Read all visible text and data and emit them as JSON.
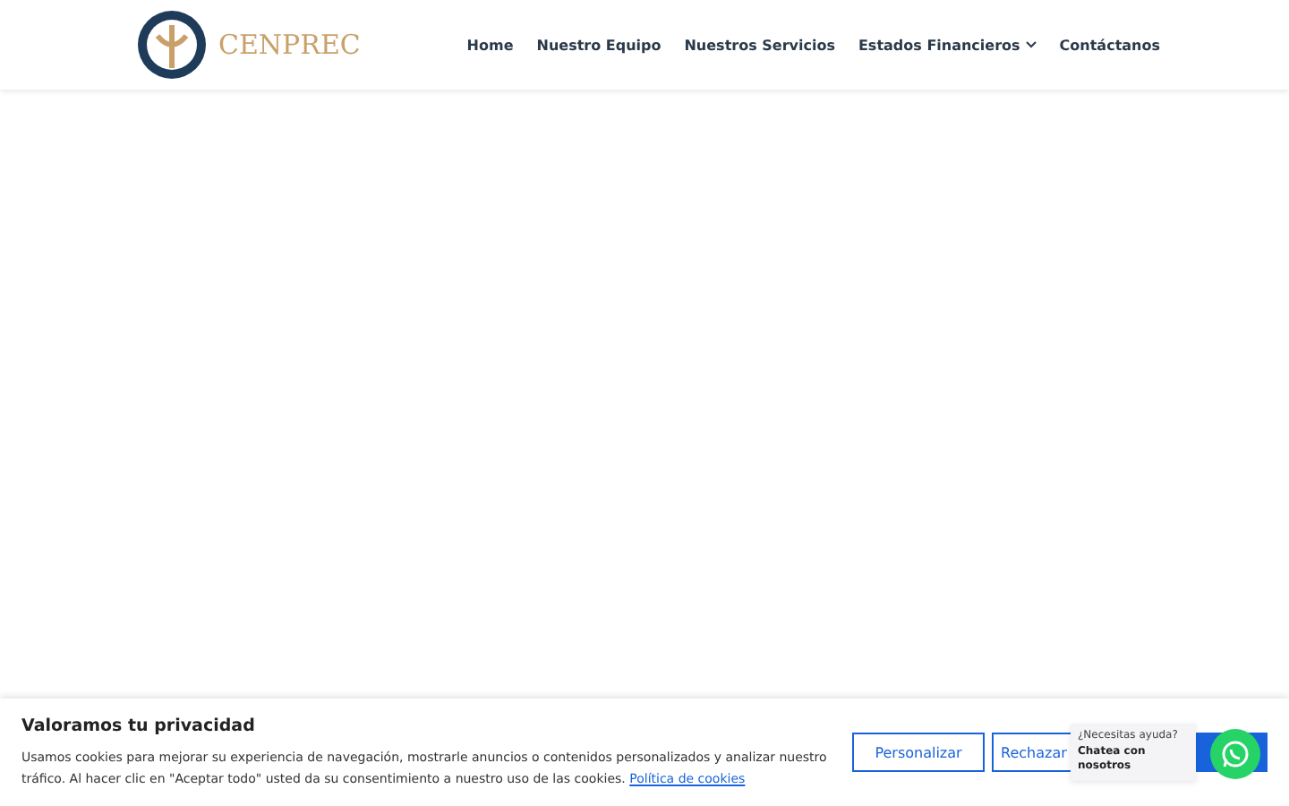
{
  "header": {
    "logo_text": "CENPREC",
    "nav": [
      {
        "label": "Home",
        "dropdown": false
      },
      {
        "label": "Nuestro Equipo",
        "dropdown": false
      },
      {
        "label": "Nuestros Servicios",
        "dropdown": false
      },
      {
        "label": "Estados Financieros",
        "dropdown": true
      },
      {
        "label": "Contáctanos",
        "dropdown": false
      }
    ]
  },
  "cookie_banner": {
    "title": "Valoramos tu privacidad",
    "text": "Usamos cookies para mejorar su experiencia de navegación, mostrarle anuncios o contenidos personalizados y analizar nuestro tráfico. Al hacer clic en \"Aceptar todo\" usted da su consentimiento a nuestro uso de las cookies.",
    "link": "Política de cookies",
    "buttons": [
      {
        "label": "Personalizar",
        "kind": "outline"
      },
      {
        "label": "Rechazar",
        "kind": "outline"
      },
      {
        "kind": "primary"
      }
    ]
  },
  "chat": {
    "hint": "¿Necesitas ayuda?",
    "cta": "Chatea con nosotros"
  }
}
